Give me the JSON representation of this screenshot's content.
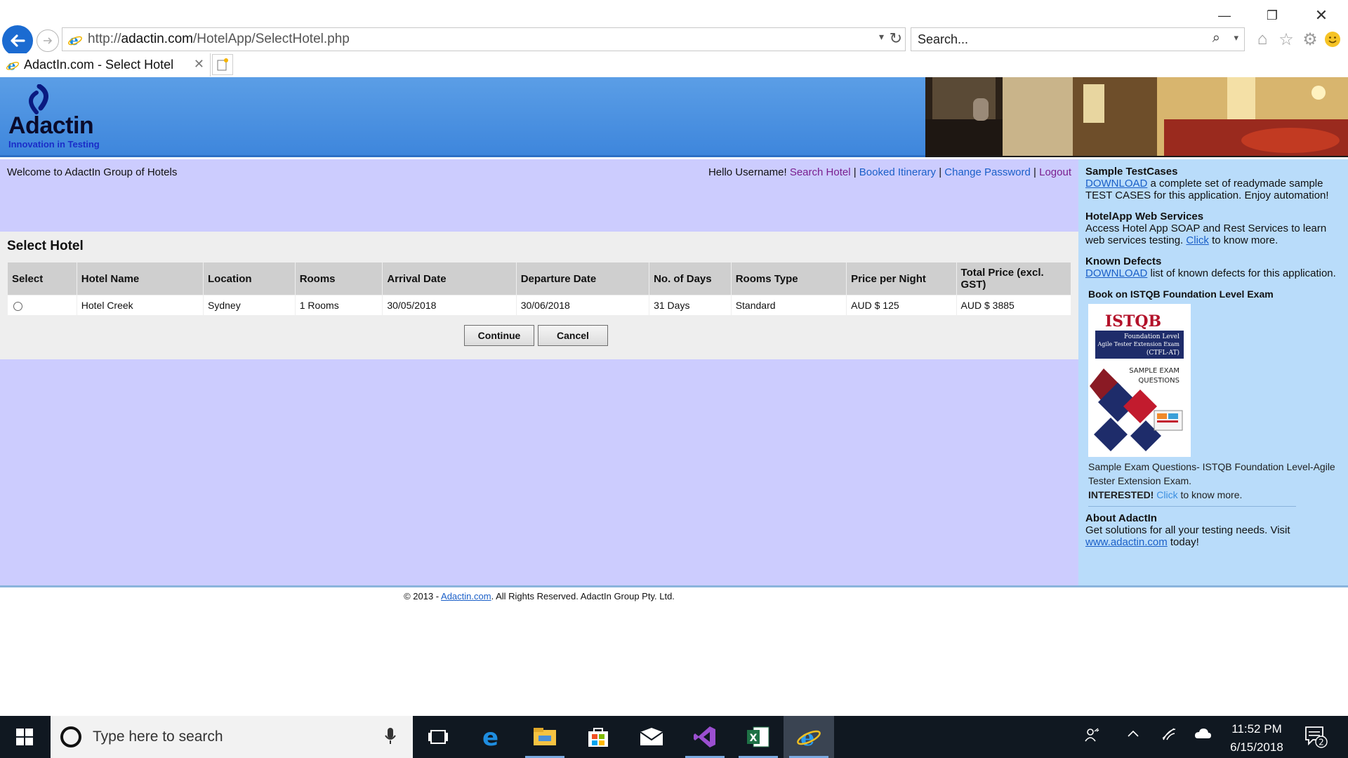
{
  "browser": {
    "url_prefix": "http://",
    "url_domain": "adactin.com",
    "url_path": "/HotelApp/SelectHotel.php",
    "search_placeholder": "Search...",
    "tab_title": "AdactIn.com - Select Hotel"
  },
  "header": {
    "logo_word": "Adactin",
    "logo_tagline": "Innovation in Testing"
  },
  "topbar": {
    "welcome": "Welcome to AdactIn Group of Hotels",
    "greeting": "Hello Username!",
    "nav": [
      "Search Hotel",
      "Booked Itinerary",
      "Change Password",
      "Logout"
    ],
    "separator": "|"
  },
  "content": {
    "title": "Select Hotel",
    "columns": [
      "Select",
      "Hotel Name",
      "Location",
      "Rooms",
      "Arrival Date",
      "Departure Date",
      "No. of Days",
      "Rooms Type",
      "Price per Night",
      "Total Price (excl. GST)"
    ],
    "rows": [
      {
        "hotel_name": "Hotel Creek",
        "location": "Sydney",
        "rooms": "1 Rooms",
        "arrival": "30/05/2018",
        "departure": "30/06/2018",
        "days": "31 Days",
        "room_type": "Standard",
        "price_per_night": "AUD $ 125",
        "total_price": "AUD $ 3885",
        "selected": false
      }
    ],
    "continue_label": "Continue",
    "cancel_label": "Cancel"
  },
  "sidebar": {
    "testcases_title": "Sample TestCases",
    "testcases_link": "DOWNLOAD",
    "testcases_text": " a complete set of readymade sample TEST CASES for this application. Enjoy automation!",
    "ws_title": "HotelApp Web Services",
    "ws_text": "Access Hotel App SOAP and Rest Services to learn web services testing. ",
    "ws_link": "Click",
    "ws_text2": " to know more.",
    "defects_title": "Known Defects",
    "defects_link": "DOWNLOAD",
    "defects_text": " list of known defects for this application.",
    "book_title": "Book on ISTQB Foundation Level Exam",
    "book_cover": {
      "brand": "ISTQB",
      "line1": "Foundation Level",
      "line2": "Agile Tester Extension Exam",
      "line3": "(CTFL-AT)",
      "line4": "SAMPLE EXAM",
      "line5": "QUESTIONS"
    },
    "book_caption1": "Sample Exam Questions- ISTQB Foundation Level-Agile Tester Extension Exam.",
    "book_interested": "INTERESTED!",
    "book_click": "Click",
    "book_caption2": " to know more.",
    "about_title": "About AdactIn",
    "about_text": "Get solutions for all your testing needs. Visit ",
    "about_link": "www.adactin.com",
    "about_text2": " today!"
  },
  "footer": {
    "prefix": "© 2013 - ",
    "link": "Adactin.com",
    "suffix": ". All Rights Reserved. AdactIn Group Pty. Ltd."
  },
  "taskbar": {
    "search_placeholder": "Type here to search",
    "time": "11:52 PM",
    "date": "6/15/2018",
    "notification_count": "2"
  },
  "colors": {
    "banner_top": "#5b9ee6",
    "main_bg": "#ccccfe",
    "sidebar_bg": "#b9dcfa",
    "link_purple": "#7a1f8f",
    "link_blue": "#1a5fc8"
  }
}
